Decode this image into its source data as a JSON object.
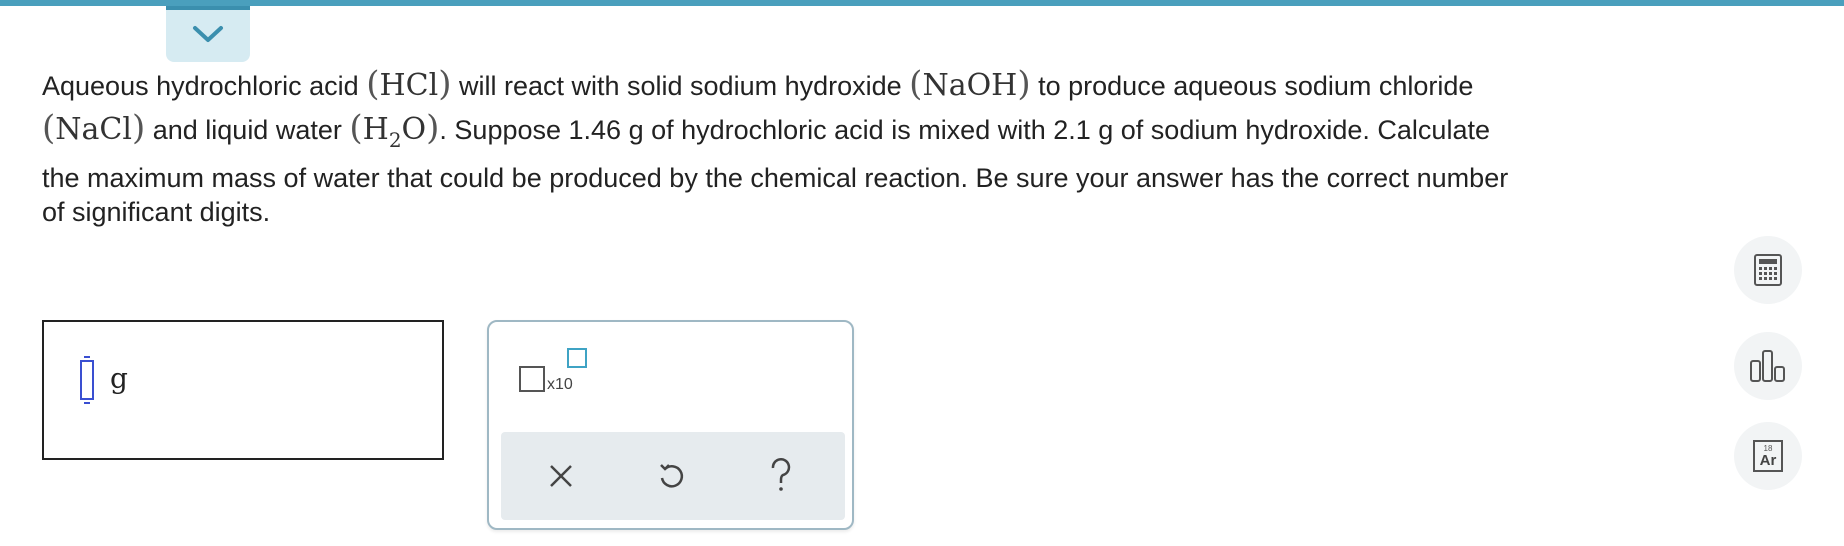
{
  "question": {
    "line1": {
      "t1": "Aqueous hydrochloric acid",
      "f1": "HCl",
      "t2": "will react with solid sodium hydroxide",
      "f2": "NaOH",
      "t3": "to produce aqueous sodium chloride"
    },
    "line2": {
      "f1": "NaCl",
      "t1": "and liquid water",
      "f2_main": "H",
      "f2_sub": "2",
      "f2_end": "O",
      "t2": ". Suppose 1.46 g of hydrochloric acid is mixed with 2.1 g of sodium hydroxide. Calculate"
    },
    "line3": "the maximum mass of water that could be produced by the chemical reaction. Be sure your answer has the correct number",
    "line4": "of significant digits."
  },
  "answer": {
    "value": "",
    "unit": "g"
  },
  "tools": {
    "sci_notation_label": "x10",
    "actions": [
      "clear-icon",
      "undo-icon",
      "help-icon"
    ]
  },
  "side_tools": {
    "calculator": "calculator-icon",
    "data": "data-chart-icon",
    "periodic": {
      "number": "18",
      "symbol": "Ar"
    }
  },
  "colors": {
    "accent": "#4a9fbd",
    "cursor": "#3a4fd1",
    "exponent_box": "#3fa3c4"
  }
}
